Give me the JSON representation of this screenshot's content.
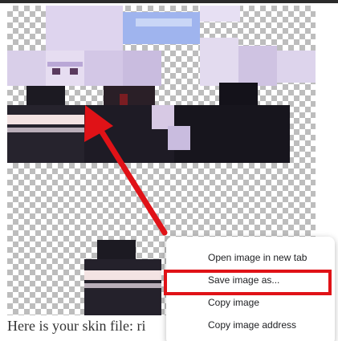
{
  "image": {
    "alt": "Minecraft skin texture",
    "colors": {
      "checker_light": "#ffffff",
      "checker_dark": "#bdbdbd",
      "hair": "#ded4ee",
      "hair_shadow": "#b9a7d6",
      "jacket": "#1c1a22",
      "shirt_stripe": "#f3e3e3",
      "banner": "#9fb4ee",
      "arrow": "#e01217"
    }
  },
  "caption": {
    "text": "Here is your skin file: ri"
  },
  "context_menu": {
    "items": [
      {
        "label": "Open image in new tab"
      },
      {
        "label": "Save image as..."
      },
      {
        "label": "Copy image"
      },
      {
        "label": "Copy image address"
      }
    ],
    "highlight_color": "#e01217"
  }
}
